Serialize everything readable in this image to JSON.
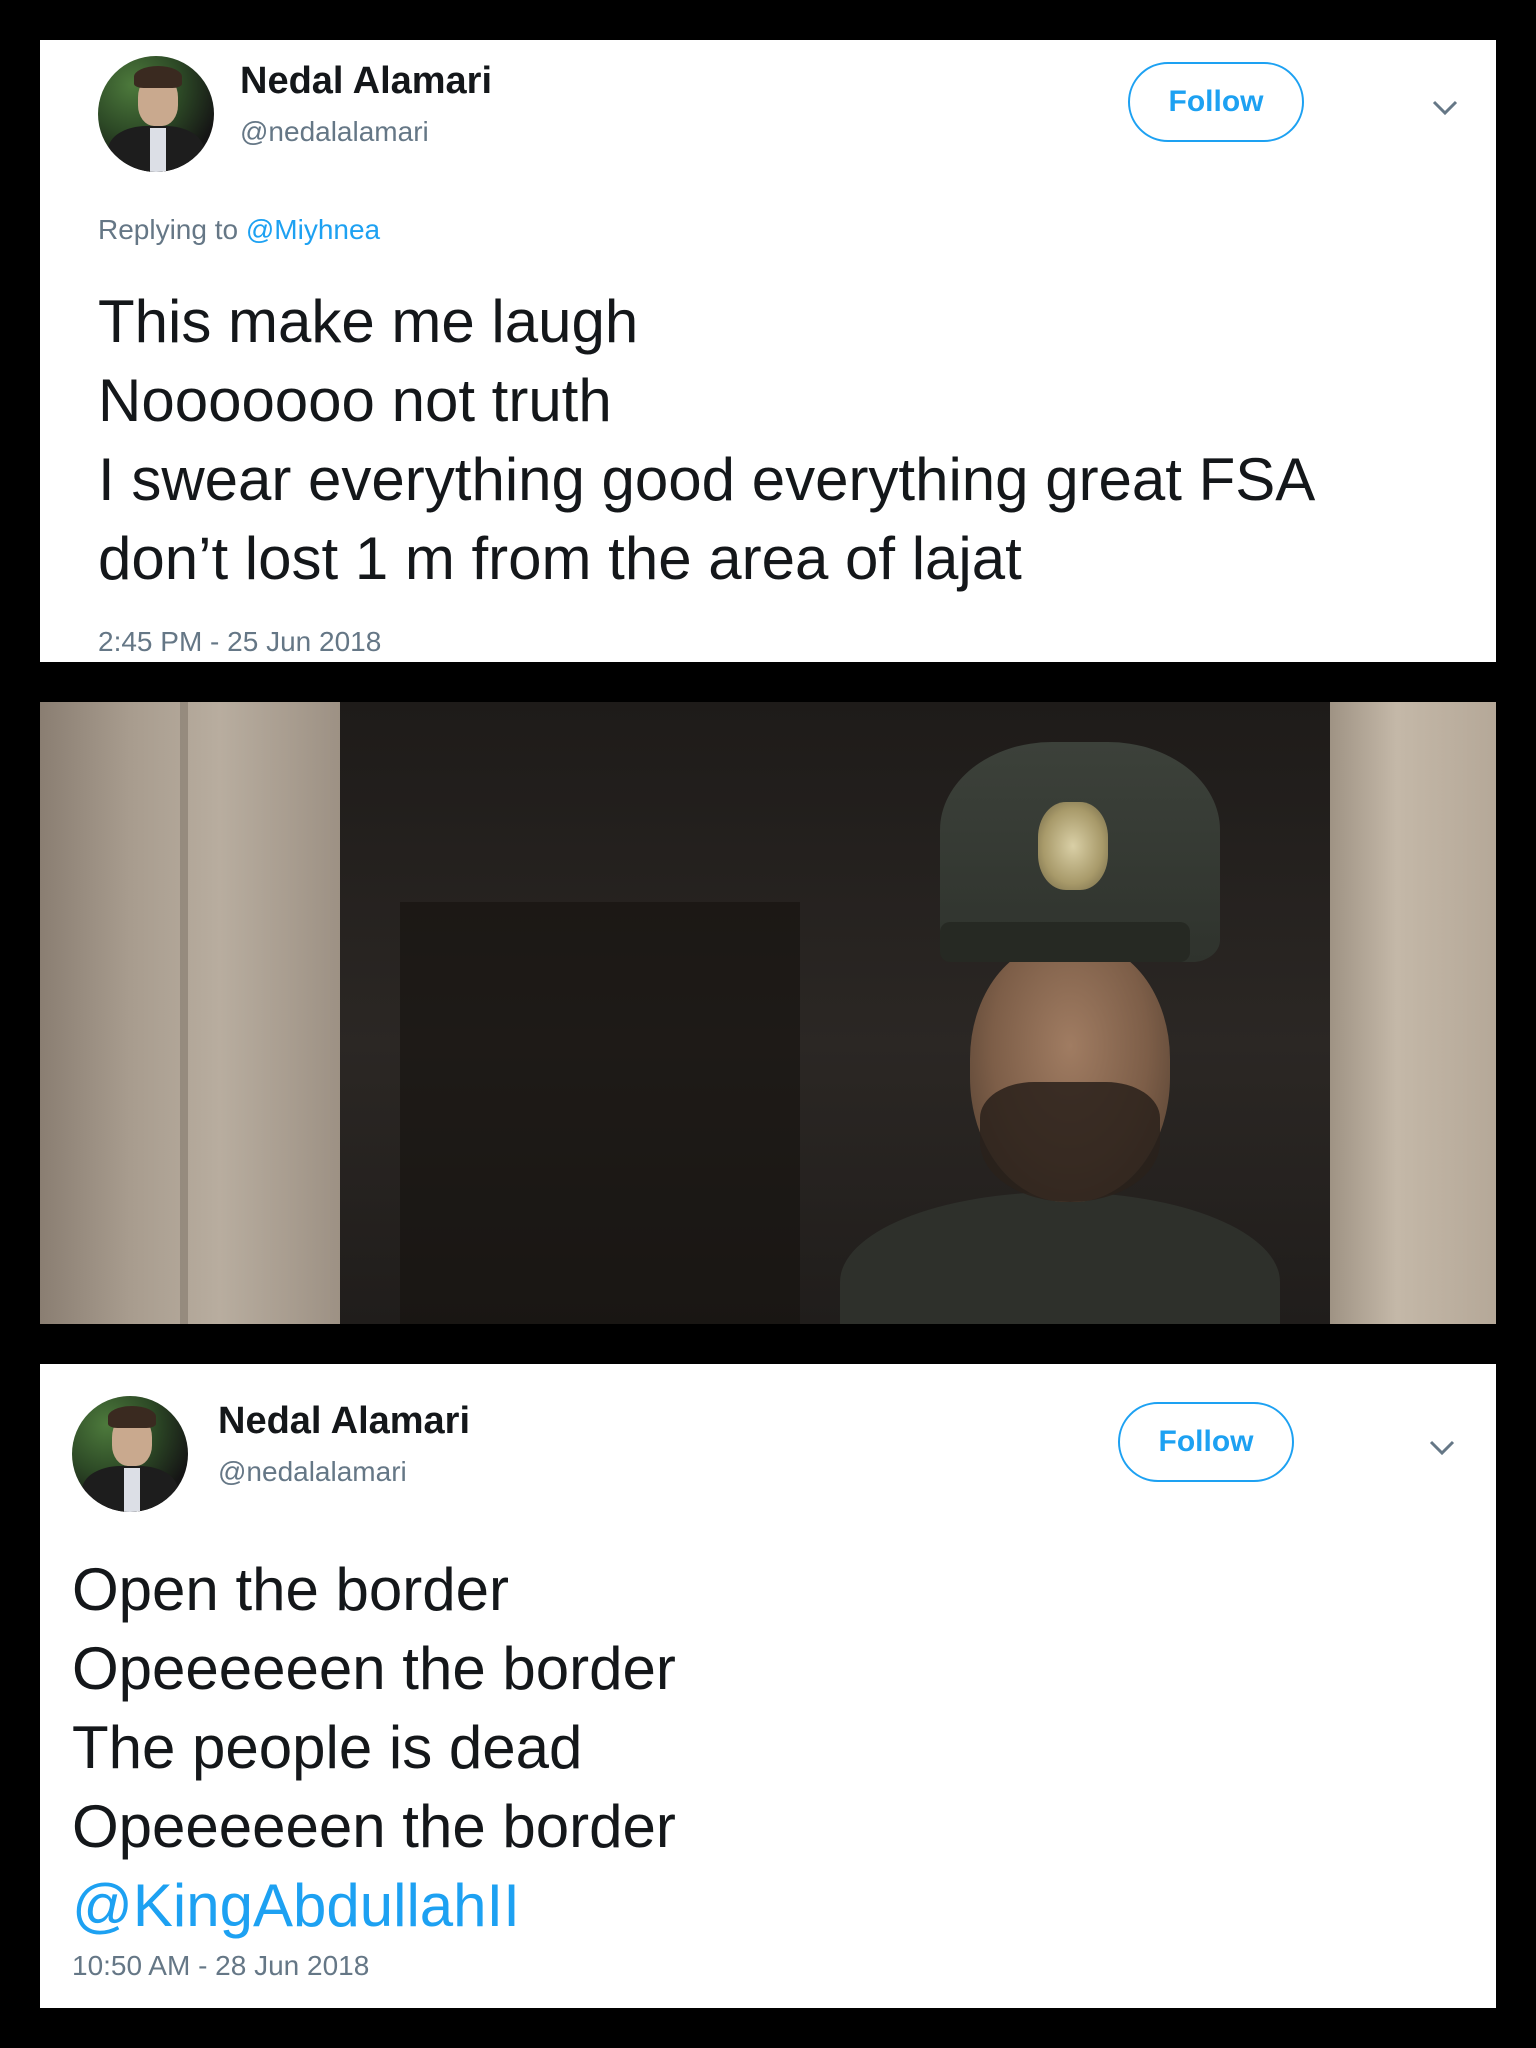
{
  "tweet1": {
    "author_name": "Nedal Alamari",
    "author_handle": "@nedalalamari",
    "follow_label": "Follow",
    "replying_prefix": "Replying to",
    "replying_to": "@Miyhnea",
    "lines": [
      "This make me laugh",
      "Nooooooo not truth",
      "I swear everything good everything great FSA",
      "don’t lost 1 m from the area of lajat"
    ],
    "timestamp": "2:45 PM - 25 Jun 2018"
  },
  "photo": {
    "subject": "soldier-in-doorway"
  },
  "tweet2": {
    "author_name": "Nedal Alamari",
    "author_handle": "@nedalalamari",
    "follow_label": "Follow",
    "lines": [
      "Open the border",
      "Opeeeeeen the border",
      "The people is dead",
      "Opeeeeeen the border"
    ],
    "mention": "@KingAbdullahII",
    "timestamp": "10:50 AM - 28 Jun 2018"
  },
  "colors": {
    "link": "#1da1f2",
    "text": "#14171a",
    "muted": "#657786",
    "background": "#000000"
  },
  "icons": [
    "chevron-down-icon"
  ]
}
